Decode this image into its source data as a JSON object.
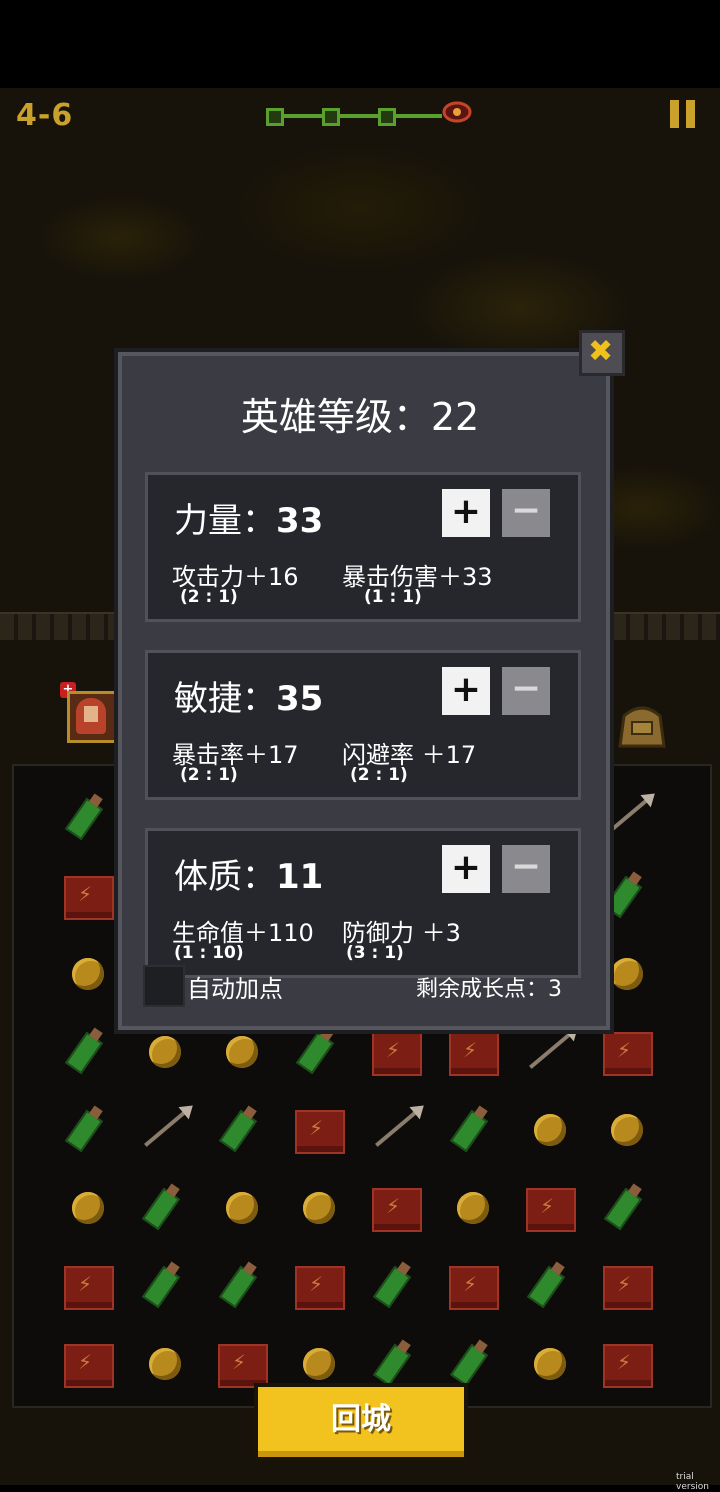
{
  "hud": {
    "level": "4-6",
    "stage_progress_nodes": 3,
    "pause_icon": "pause-icon",
    "boss_icon": "boss-eye-icon"
  },
  "dialog": {
    "title": "英雄等级：22",
    "close_icon": "close-icon",
    "stats": [
      {
        "name": "力量：",
        "value": "33",
        "plus": "+",
        "minus": "−",
        "effects": [
          {
            "label": "攻击力＋16",
            "ratio": "(2 : 1)"
          },
          {
            "label": "暴击伤害＋33",
            "ratio": "(1 : 1)"
          }
        ]
      },
      {
        "name": "敏捷：",
        "value": "35",
        "plus": "+",
        "minus": "−",
        "effects": [
          {
            "label": "暴击率＋17",
            "ratio": "(2 : 1)"
          },
          {
            "label": "闪避率 ＋17",
            "ratio": "(2 : 1)"
          }
        ]
      },
      {
        "name": "体质：",
        "value": "11",
        "plus": "+",
        "minus": "−",
        "effects": [
          {
            "label": "生命值＋110",
            "ratio": "(1 : 10)"
          },
          {
            "label": "防御力 ＋3",
            "ratio": "(3 : 1)"
          }
        ]
      }
    ],
    "auto_label": "自动加点",
    "remaining_points": "剩余成长点：3"
  },
  "bottom": {
    "town_button": "回城"
  },
  "watermark": "trial version",
  "colors": {
    "accent_gold": "#c9a12b",
    "button_yellow": "#f2c21f",
    "dialog_bg": "#3a3b43",
    "card_bg": "#26272d"
  }
}
